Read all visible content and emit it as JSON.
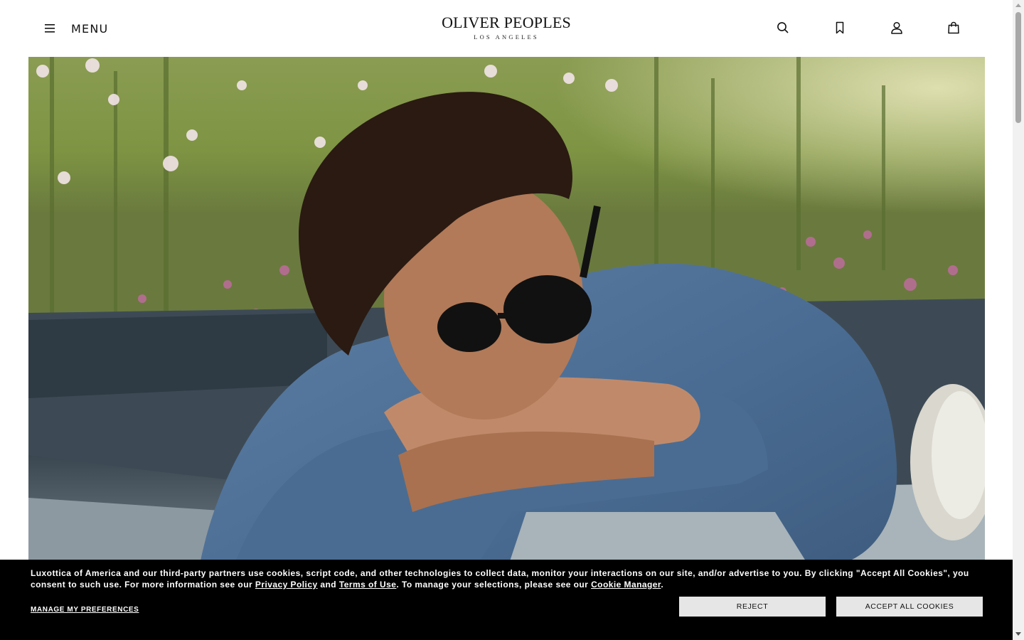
{
  "header": {
    "menu_label": "MENU",
    "logo_main": "OLIVER PEOPLES",
    "logo_sub": "LOS ANGELES",
    "icons": [
      "hamburger-icon",
      "search-icon",
      "bookmark-icon",
      "user-icon",
      "shopping-bag-icon"
    ]
  },
  "hero": {
    "description_icon": "hero-image"
  },
  "cookie_banner": {
    "text_part1": "Luxottica of America and our third-party partners use cookies, script code, and other technologies to collect data, monitor your interactions on our site, and/or advertise to you. By clicking \"Accept All Cookies\", you consent to such use. For more information see our ",
    "privacy_link": "Privacy Policy",
    "text_and": " and ",
    "terms_link": "Terms of Use",
    "text_part2": ". To manage your selections, please see our ",
    "cookie_manager_link": "Cookie Manager",
    "text_end": ".",
    "manage_label": "MANAGE MY PREFERENCES",
    "reject_label": "REJECT",
    "accept_label": "ACCEPT ALL COOKIES"
  },
  "colors": {
    "banner_bg": "#000000",
    "button_bg": "#e6e6e6"
  }
}
